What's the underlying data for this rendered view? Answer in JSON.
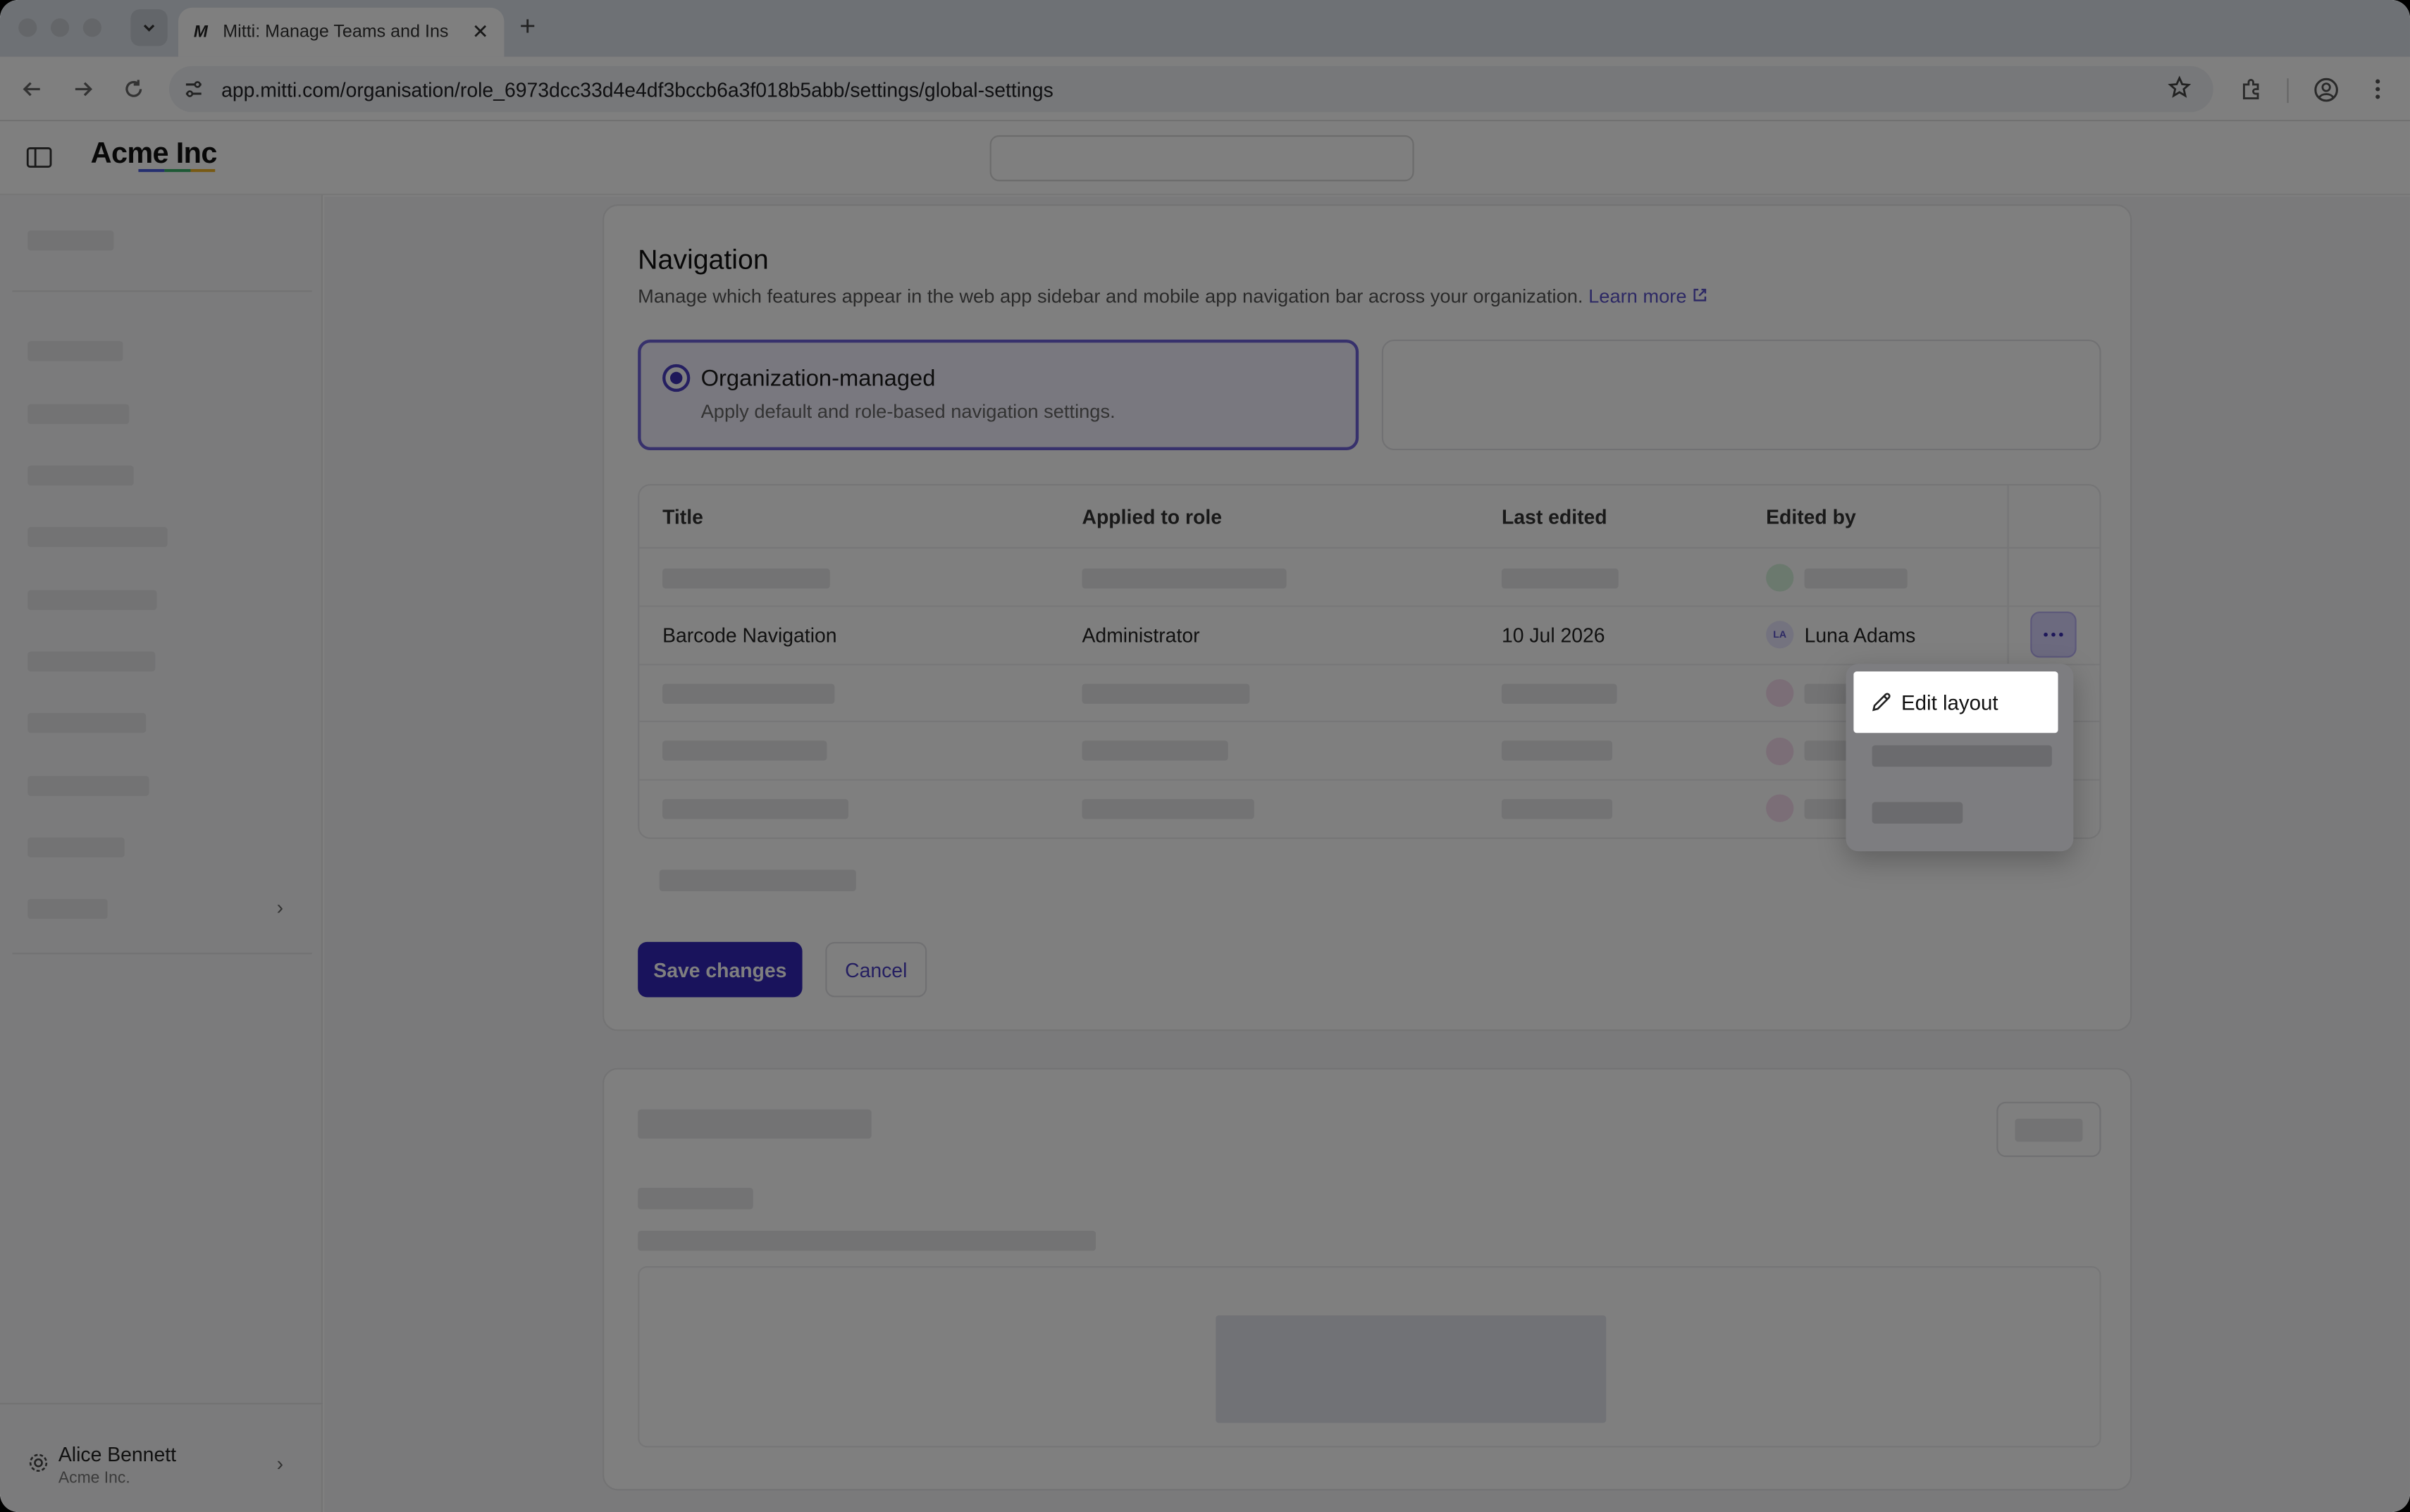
{
  "browser": {
    "tab_title": "Mitti: Manage Teams and Ins",
    "tab_favicon": "M",
    "url": "app.mitti.com/organisation/role_6973dcc33d4e4df3bccb6a3f018b5abb/settings/global-settings"
  },
  "app": {
    "logo": "Acme Inc"
  },
  "user": {
    "name": "Alice Bennett",
    "org": "Acme Inc."
  },
  "navigation": {
    "title": "Navigation",
    "description": "Manage which features appear in the web app sidebar and mobile app navigation bar across your organization.",
    "learn_more": "Learn more",
    "option_managed": {
      "title": "Organization-managed",
      "description": "Apply default and role-based navigation settings.",
      "selected": true
    },
    "table": {
      "headers": [
        "Title",
        "Applied to role",
        "Last edited",
        "Edited by"
      ],
      "row": {
        "title": "Barcode Navigation",
        "role": "Administrator",
        "last_edited": "10 Jul 2026",
        "editor_initials": "LA",
        "editor_name": "Luna Adams"
      }
    },
    "save_label": "Save changes",
    "cancel_label": "Cancel"
  },
  "menu": {
    "edit_layout": "Edit layout"
  },
  "colors": {
    "accent": "#3327b8",
    "selected_bg": "#f3f0ff",
    "overlay": "rgba(0,0,0,0.5)"
  }
}
